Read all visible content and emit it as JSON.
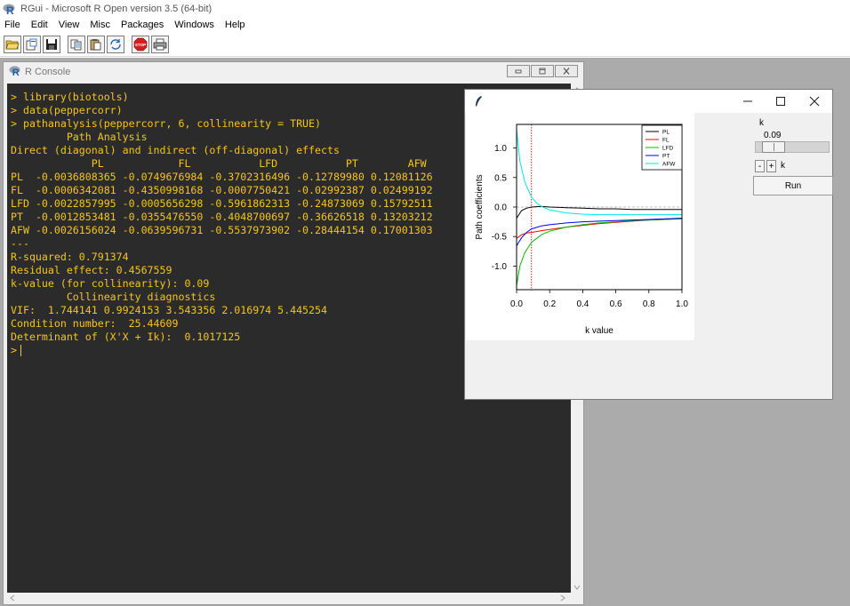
{
  "app": {
    "title": "RGui  -  Microsoft R Open version 3.5 (64-bit)",
    "menu": [
      "File",
      "Edit",
      "View",
      "Misc",
      "Packages",
      "Windows",
      "Help"
    ],
    "toolbar_icons": [
      "open-script-icon",
      "load-workspace-icon",
      "save-workspace-icon",
      "copy-icon",
      "paste-icon",
      "copy-paste-icon",
      "stop-icon",
      "print-icon"
    ]
  },
  "console": {
    "title": "R Console",
    "lines": [
      "> library(biotools)",
      "> data(peppercorr)",
      "> pathanalysis(peppercorr, 6, collinearity = TRUE)",
      "",
      "         Path Analysis",
      "",
      "Direct (diagonal) and indirect (off-diagonal) effects",
      "             PL            FL           LFD           PT        AFW",
      "PL  -0.0036808365 -0.0749676984 -0.3702316496 -0.12789980 0.12081126",
      "FL  -0.0006342081 -0.4350998168 -0.0007750421 -0.02992387 0.02499192",
      "LFD -0.0022857995 -0.0005656298 -0.5961862313 -0.24873069 0.15792511",
      "PT  -0.0012853481 -0.0355476550 -0.4048700697 -0.36626518 0.13203212",
      "AFW -0.0026156024 -0.0639596731 -0.5537973902 -0.28444154 0.17001303",
      "---",
      "R-squared: 0.791374",
      "Residual effect: 0.4567559",
      "k-value (for collinearity): 0.09",
      "",
      "         Collinearity diagnostics",
      "",
      "VIF:  1.744141 0.9924153 3.543356 2.016974 5.445254",
      "Condition number:  25.44609",
      "Determinant of (X'X + Ik):  0.1017125"
    ],
    "prompt": ">"
  },
  "plot_window": {
    "controls": {
      "k_label": "k",
      "k_value": "0.09",
      "slider_value": 0.09,
      "minus_label": "-",
      "plus_label": "+",
      "k_small_label": "k",
      "run_label": "Run"
    }
  },
  "chart_data": {
    "type": "line",
    "xlabel": "k value",
    "ylabel": "Path coefficients",
    "xlim": [
      0,
      1
    ],
    "ylim": [
      -1.4,
      1.4
    ],
    "xticks": [
      "0.0",
      "0.2",
      "0.4",
      "0.6",
      "0.8",
      "1.0"
    ],
    "yticks": [
      "-1.0",
      "-0.5",
      "0.0",
      "0.5",
      "1.0"
    ],
    "reference_k": 0.09,
    "legend_position": "top-right",
    "series": [
      {
        "name": "PL",
        "color": "#000000",
        "x": [
          0.0,
          0.03,
          0.06,
          0.09,
          0.15,
          0.2,
          0.3,
          0.4,
          0.5,
          0.6,
          0.7,
          0.8,
          0.9,
          1.0
        ],
        "y": [
          -0.19,
          -0.06,
          -0.02,
          0.0,
          0.01,
          0.0,
          -0.01,
          -0.02,
          -0.03,
          -0.03,
          -0.04,
          -0.04,
          -0.04,
          -0.04
        ]
      },
      {
        "name": "FL",
        "color": "#ff0000",
        "x": [
          0.0,
          0.03,
          0.06,
          0.09,
          0.15,
          0.2,
          0.3,
          0.4,
          0.5,
          0.6,
          0.7,
          0.8,
          0.9,
          1.0
        ],
        "y": [
          -0.53,
          -0.47,
          -0.44,
          -0.43,
          -0.4,
          -0.38,
          -0.34,
          -0.31,
          -0.28,
          -0.26,
          -0.24,
          -0.22,
          -0.21,
          -0.19
        ]
      },
      {
        "name": "LFD",
        "color": "#00bb00",
        "x": [
          0.0,
          0.02,
          0.05,
          0.09,
          0.15,
          0.2,
          0.3,
          0.4,
          0.5,
          0.6,
          0.7,
          0.8,
          0.9,
          1.0
        ],
        "y": [
          -1.33,
          -1.0,
          -0.77,
          -0.6,
          -0.47,
          -0.41,
          -0.34,
          -0.3,
          -0.27,
          -0.25,
          -0.23,
          -0.22,
          -0.21,
          -0.2
        ]
      },
      {
        "name": "PT",
        "color": "#0000ff",
        "x": [
          0.0,
          0.03,
          0.06,
          0.09,
          0.15,
          0.2,
          0.3,
          0.4,
          0.5,
          0.6,
          0.7,
          0.8,
          0.9,
          1.0
        ],
        "y": [
          -0.66,
          -0.52,
          -0.43,
          -0.37,
          -0.32,
          -0.3,
          -0.27,
          -0.25,
          -0.24,
          -0.23,
          -0.22,
          -0.21,
          -0.2,
          -0.19
        ]
      },
      {
        "name": "AFW",
        "color": "#00e5e5",
        "x": [
          0.0,
          0.02,
          0.05,
          0.09,
          0.12,
          0.15,
          0.2,
          0.3,
          0.4,
          0.5,
          0.6,
          0.7,
          0.8,
          0.9,
          1.0
        ],
        "y": [
          1.32,
          0.78,
          0.42,
          0.17,
          0.07,
          0.01,
          -0.05,
          -0.1,
          -0.12,
          -0.13,
          -0.13,
          -0.13,
          -0.13,
          -0.13,
          -0.13
        ]
      }
    ]
  }
}
